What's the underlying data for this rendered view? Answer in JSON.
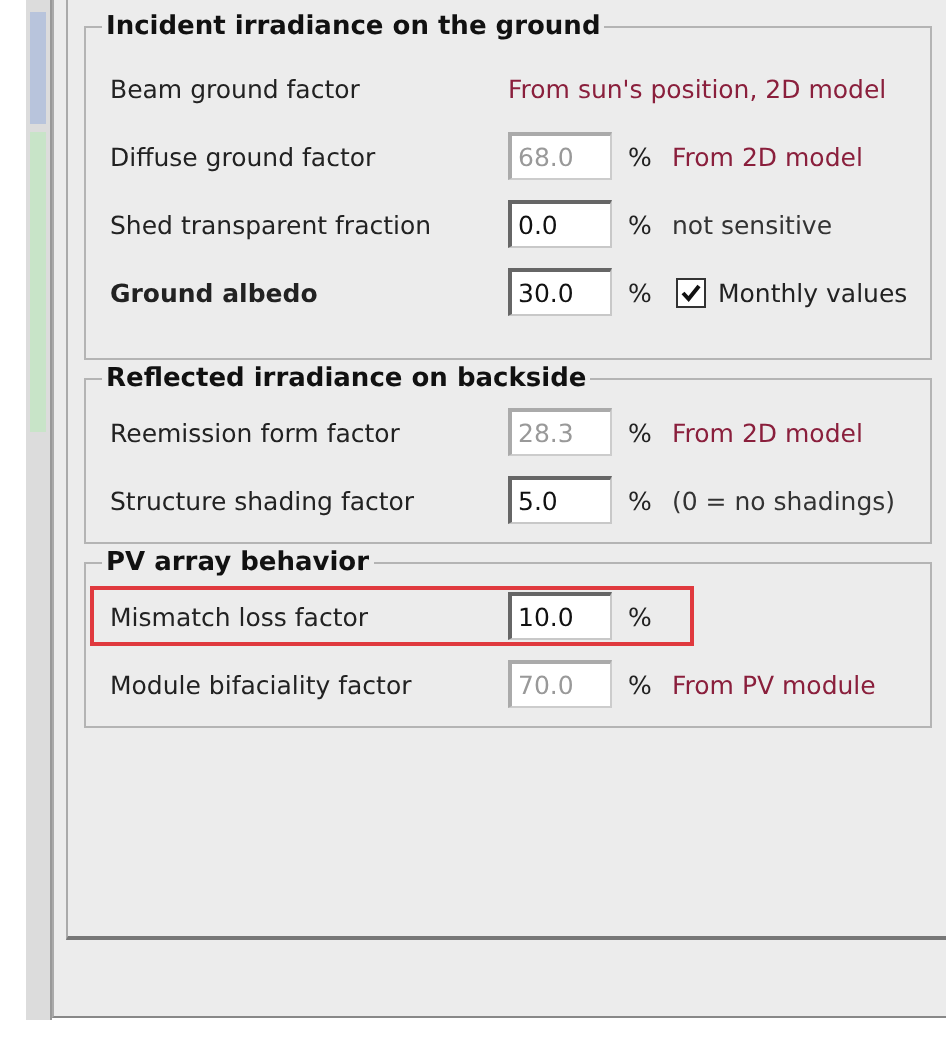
{
  "groups": [
    {
      "title": "Incident irradiance on the ground",
      "rows": [
        {
          "label": "Beam ground factor",
          "bold": false,
          "highlighted": false,
          "note": {
            "text": "From sun's position, 2D model",
            "color": "#8a1f3c"
          }
        },
        {
          "label": "Diffuse ground factor",
          "bold": false,
          "highlighted": false,
          "field": {
            "value": "68.0",
            "disabled": true
          },
          "unit": "%",
          "note": {
            "text": "From 2D model",
            "color": "#8a1f3c"
          }
        },
        {
          "label": "Shed transparent fraction",
          "bold": false,
          "highlighted": false,
          "field": {
            "value": "0.0",
            "disabled": false
          },
          "unit": "%",
          "note": {
            "text": "not sensitive",
            "color": "#333333"
          }
        },
        {
          "label": "Ground albedo",
          "bold": true,
          "highlighted": false,
          "field": {
            "value": "30.0",
            "disabled": false
          },
          "unit": "%",
          "checkbox": {
            "label": "Monthly values",
            "checked": true
          }
        }
      ]
    },
    {
      "title": "Reflected irradiance on backside",
      "rows": [
        {
          "label": "Reemission form factor",
          "bold": false,
          "highlighted": false,
          "field": {
            "value": "28.3",
            "disabled": true
          },
          "unit": "%",
          "note": {
            "text": "From 2D model",
            "color": "#8a1f3c"
          }
        },
        {
          "label": "Structure shading factor",
          "bold": false,
          "highlighted": false,
          "field": {
            "value": "5.0",
            "disabled": false
          },
          "unit": "%",
          "note": {
            "text": "(0 = no shadings)",
            "color": "#333333"
          }
        }
      ]
    },
    {
      "title": "PV array behavior",
      "rows": [
        {
          "label": "Mismatch loss factor",
          "bold": false,
          "highlighted": true,
          "field": {
            "value": "10.0",
            "disabled": false
          },
          "unit": "%"
        },
        {
          "label": "Module bifaciality factor",
          "bold": false,
          "highlighted": false,
          "field": {
            "value": "70.0",
            "disabled": true
          },
          "unit": "%",
          "note": {
            "text": "From PV module",
            "color": "#8a1f3c"
          }
        }
      ]
    }
  ]
}
